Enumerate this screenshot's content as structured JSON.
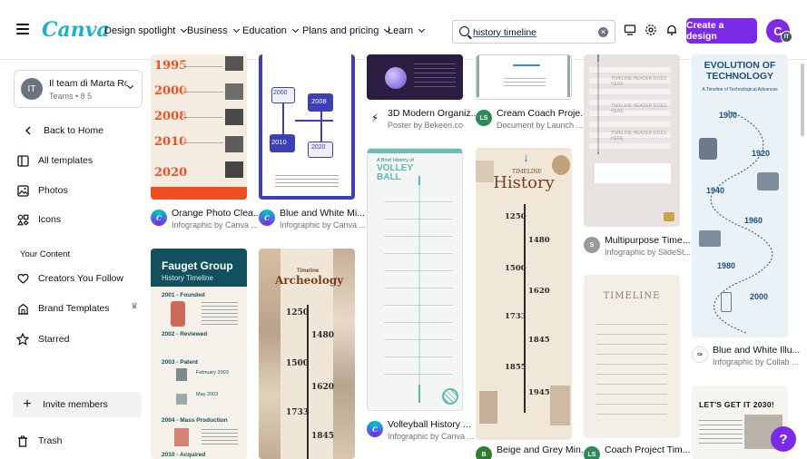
{
  "topbar": {
    "logo": "Canva",
    "nav": [
      {
        "label": "Design spotlight"
      },
      {
        "label": "Business"
      },
      {
        "label": "Education"
      },
      {
        "label": "Plans and pricing"
      },
      {
        "label": "Learn"
      }
    ],
    "search_value": "history timeline",
    "create_label": "Create a design",
    "avatar_letter": "C",
    "avatar_badge": "IT"
  },
  "sidebar": {
    "team_initials": "IT",
    "team_name": "Il team di Marta Ro...",
    "team_sub": "Teams • 8 5",
    "back": "Back to Home",
    "items": [
      "All templates",
      "Photos",
      "Icons"
    ],
    "section": "Your Content",
    "content_items": [
      "Creators You Follow",
      "Brand Templates",
      "Starred"
    ],
    "invite": "Invite members",
    "trash": "Trash"
  },
  "cards": [
    {
      "title": "Orange Photo Clea...",
      "sub": "Infographic by Canva ..."
    },
    {
      "title": "Blue and White Mi...",
      "sub": "Infographic by Canva ..."
    },
    {
      "title": "3D Modern Organiz...",
      "sub": "Poster by Bekeen.co"
    },
    {
      "title": "Cream Coach Proje...",
      "sub": "Document by Launch ..."
    },
    {
      "title": "Multipurpose Time...",
      "sub": "Infographic by SlideSt..."
    },
    {
      "title": "Blue and White Illu...",
      "sub": "Infographic by Collab ..."
    },
    {
      "title": "Volleyball History ...",
      "sub": "Infographic by Canva ..."
    },
    {
      "title": "Beige and Grey Min...",
      "sub": ""
    },
    {
      "title": "Coach Project Tim...",
      "sub": ""
    }
  ],
  "thumbs": {
    "orange_years": [
      "1995",
      "2000",
      "2008",
      "2010",
      "2020"
    ],
    "blue_years": [
      "2000",
      "2008",
      "2010",
      "2020"
    ],
    "fauget_title": "Fauget Group",
    "fauget_sub": "History Timeline",
    "fauget_items": [
      "2001 - Founded",
      "2002 - Reviewed",
      "2003 - Patent",
      "2004 - Mass Production",
      "2010 - Acquired"
    ],
    "fauget_side": [
      "February 2003",
      "May 2003"
    ],
    "arch_small": "Timeline",
    "arch_title": "Archeology",
    "arch_years": [
      "1250",
      "1480",
      "1500",
      "1620",
      "1733",
      "1845"
    ],
    "volley_small": "A Brief History of",
    "volley_title": "VOLLEY BALL",
    "hist_small": "TIMELINE",
    "hist_title": "History",
    "hist_years": [
      "1250",
      "1480",
      "1500",
      "1620",
      "1733",
      "1845",
      "1855",
      "1945"
    ],
    "multi_bars": [
      "TIMELINE HEADER GOES HERE",
      "TIMELINE HEADER GOES HERE",
      "TIMELINE HEADER GOES HERE"
    ],
    "evol_title": "EVOLUTION OF TECHNOLOGY",
    "evol_sub": "A Timeline of Technological Advances",
    "evol_years": [
      "1900",
      "1920",
      "1940",
      "1960",
      "1980",
      "2000"
    ],
    "coach_title": "TIMELINE",
    "lets": "LET'S GET IT 2030!"
  },
  "help": "?"
}
